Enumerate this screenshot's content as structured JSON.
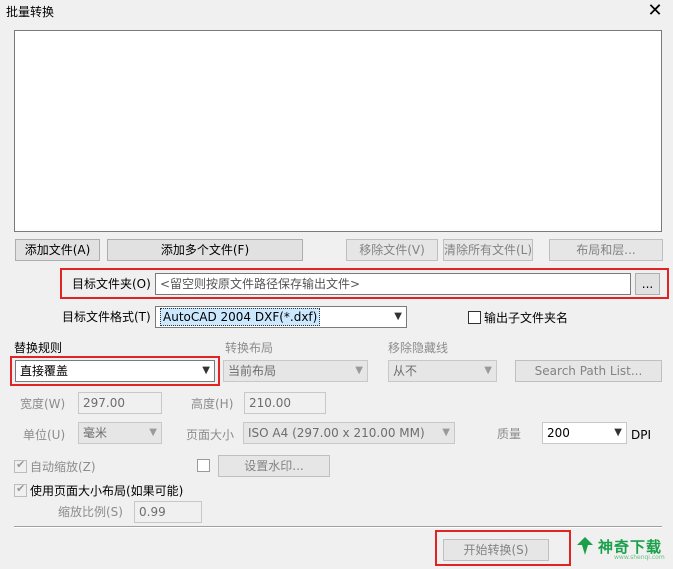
{
  "window": {
    "title": "批量转换"
  },
  "buttons": {
    "add_file": "添加文件(A)",
    "add_multiple": "添加多个文件(F)",
    "remove_file": "移除文件(V)",
    "clear_all": "清除所有文件(L)",
    "layout_layers": "布局和层...",
    "browse": "...",
    "search_path": "Search Path List...",
    "watermark": "设置水印...",
    "start": "开始转换(S)"
  },
  "target_folder": {
    "label": "目标文件夹(O)",
    "placeholder": "<留空则按原文件路径保存输出文件>"
  },
  "target_format": {
    "label": "目标文件格式(T)",
    "value": "AutoCAD 2004 DXF(*.dxf)"
  },
  "output_subfolder": {
    "label": "输出子文件夹名",
    "checked": false
  },
  "replace_rule": {
    "label": "替换规则",
    "value": "直接覆盖"
  },
  "convert_layout": {
    "label": "转换布局",
    "value": "当前布局"
  },
  "remove_hidden": {
    "label": "移除隐藏线",
    "value": "从不"
  },
  "width": {
    "label": "宽度(W)",
    "value": "297.00"
  },
  "height": {
    "label": "高度(H)",
    "value": "210.00"
  },
  "unit": {
    "label": "单位(U)",
    "value": "毫米"
  },
  "page_size": {
    "label": "页面大小",
    "value": "ISO A4 (297.00 x 210.00 MM)"
  },
  "quality": {
    "label": "质量",
    "value": "200",
    "unit": "DPI"
  },
  "auto_scale": {
    "label": "自动缩放(Z)",
    "checked": true
  },
  "watermark_enabled": {
    "checked": false
  },
  "use_page_size_layout": {
    "label": "使用页面大小布局(如果可能)",
    "checked": true
  },
  "scale_ratio": {
    "label": "缩放比例(S)",
    "value": "0.99"
  },
  "brand": {
    "name": "神奇下载",
    "sub": "www.shenqi.com"
  },
  "colors": {
    "highlight": "#e02424",
    "brand": "#1aa04a",
    "selection": "#cce8ff"
  }
}
